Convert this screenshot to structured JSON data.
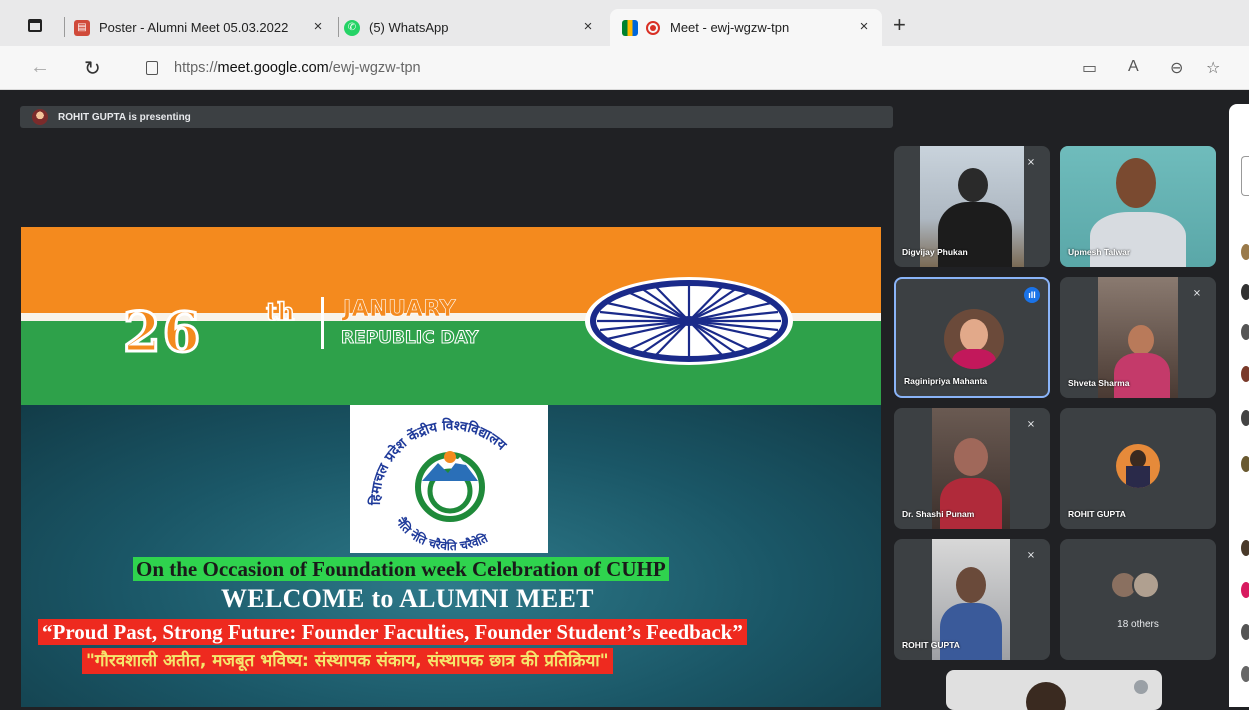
{
  "browser": {
    "tabs": [
      {
        "title": "Poster - Alumni Meet 05.03.2022",
        "close": "×"
      },
      {
        "title": "(5) WhatsApp",
        "close": "×"
      },
      {
        "title": "Meet - ewj-wgzw-tpn",
        "close": "×"
      }
    ],
    "new_tab": "+",
    "url_proto": "https://",
    "url_host": "meet.google.com",
    "url_path": "/ewj-wgzw-tpn",
    "colors": {
      "chrome_bg": "#e9e9ea",
      "active_tab": "#f7f7f7"
    }
  },
  "meet": {
    "presenting_label": "ROHIT GUPTA is presenting",
    "slide": {
      "date_number": "26",
      "date_suffix": "th",
      "month": "JANUARY",
      "republic": "REPUBLIC DAY",
      "logo_hindi_top": "हिमाचल प्रदेश केंद्रीय विश्वविद्यालय",
      "logo_hindi_bottom": "नैति नेति चरैवेति चरैवेति",
      "line1": "On the Occasion of Foundation week Celebration of CUHP",
      "line2": "WELCOME to ALUMNI MEET",
      "line3": "“Proud Past, Strong Future: Founder Faculties, Founder Student’s Feedback”",
      "line4": "\"गौरवशाली अतीत, मजबूत भविष्य: संस्थापक संकाय, संस्थापक छात्र की प्रतिक्रिया\""
    },
    "participants": [
      {
        "name": "Digvijay Phukan"
      },
      {
        "name": "Upmesh Talwar"
      },
      {
        "name": "Raginipriya Mahanta"
      },
      {
        "name": "Shveta Sharma"
      },
      {
        "name": "Dr. Shashi Punam"
      },
      {
        "name": "ROHIT GUPTA"
      },
      {
        "name": "ROHIT GUPTA"
      },
      {
        "name": "18 others"
      }
    ],
    "colors": {
      "stage_bg": "#202124",
      "tile_bg": "#3c4043",
      "speaker_ring": "#8ab4f8"
    }
  }
}
